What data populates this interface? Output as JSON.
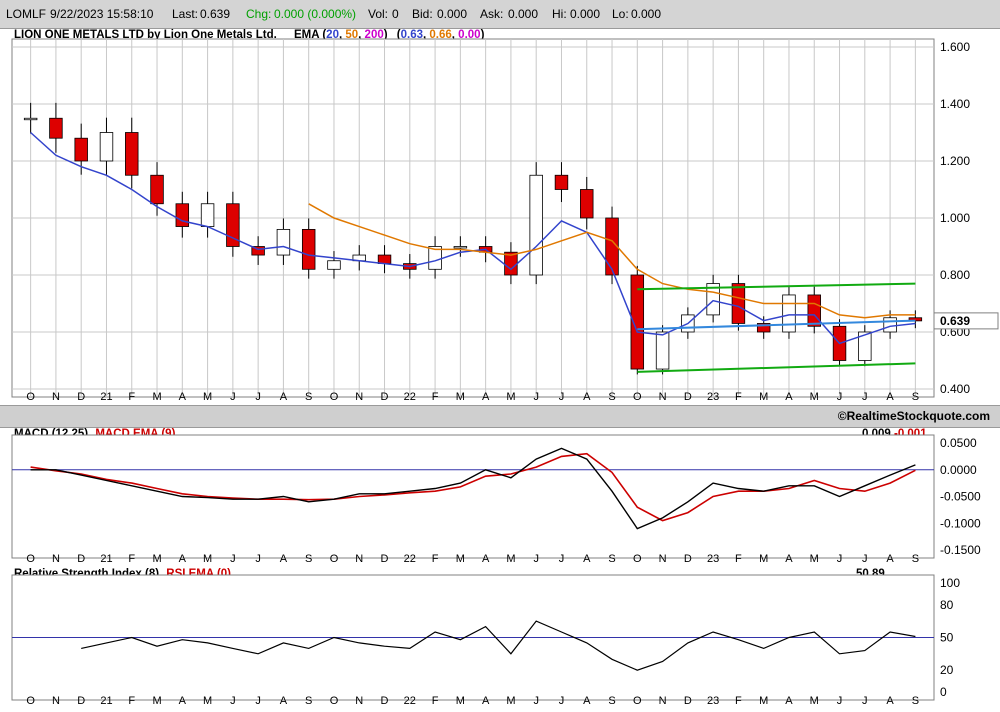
{
  "header": {
    "symbol": "LOMLF",
    "datetime": "9/22/2023 15:58:10",
    "last_label": "Last:",
    "last": "0.639",
    "chg_label": "Chg:",
    "chg": "0.000 (0.000%)",
    "vol_label": "Vol:",
    "vol": "0",
    "bid_label": "Bid:",
    "bid": "0.000",
    "ask_label": "Ask:",
    "ask": "0.000",
    "hi_label": "Hi:",
    "hi": "0.000",
    "lo_label": "Lo:",
    "lo": "0.000"
  },
  "colors": {
    "up": "#ffffff",
    "down": "#dd0000",
    "ema20": "#3344cc",
    "ema50": "#e07800",
    "ema200": "#cc00cc",
    "channel": "#11aa11",
    "channel_mid": "#3388dd",
    "macd": "#000000",
    "macd_signal": "#cc0000",
    "rsi": "#000000",
    "ref_line": "#3333aa",
    "grid": "#c8c8c8"
  },
  "price_panel": {
    "title": "LION ONE METALS LTD by Lion One Metals Ltd.",
    "ema_label": "EMA",
    "ema_periods": [
      "20",
      "50",
      "200"
    ],
    "ema_values": [
      "0.63",
      "0.66",
      "0.00"
    ],
    "last_price_label": "0.639",
    "y_ticks": [
      "1.600",
      "1.400",
      "1.200",
      "1.000",
      "0.800",
      "0.600",
      "0.400"
    ],
    "y_min": 0.4,
    "y_max": 1.6
  },
  "watermark": "©RealtimeStockquote.com",
  "x_axis_labels": [
    "O",
    "N",
    "D",
    "21",
    "F",
    "M",
    "A",
    "M",
    "J",
    "J",
    "A",
    "S",
    "O",
    "N",
    "D",
    "22",
    "F",
    "M",
    "A",
    "M",
    "J",
    "J",
    "A",
    "S",
    "O",
    "N",
    "D",
    "23",
    "F",
    "M",
    "A",
    "M",
    "J",
    "J",
    "A",
    "S"
  ],
  "macd_panel": {
    "title": "MACD (12,25)",
    "signal_label": "MACD EMA (9)",
    "value": "0.009",
    "signal_value": "-0.001",
    "y_ticks": [
      "0.0500",
      "0.0000",
      "-0.0500",
      "-0.1000",
      "-0.1500"
    ],
    "y_min": -0.15,
    "y_max": 0.05
  },
  "rsi_panel": {
    "title": "Relative Strength Index (8)",
    "ema_label": "RSI EMA (0)",
    "value": "50.89",
    "y_ticks": [
      "100",
      "80",
      "50",
      "20",
      "0"
    ],
    "y_min": 0,
    "y_max": 100
  },
  "chart_data": [
    {
      "type": "line",
      "name": "price",
      "x_labels": [
        "O",
        "N",
        "D",
        "21",
        "F",
        "M",
        "A",
        "M",
        "J",
        "J",
        "A",
        "S",
        "O",
        "N",
        "D",
        "22",
        "F",
        "M",
        "A",
        "M",
        "J",
        "J",
        "A",
        "S",
        "O",
        "N",
        "D",
        "23",
        "F",
        "M",
        "A",
        "M",
        "J",
        "J",
        "A",
        "S"
      ],
      "closes": [
        1.35,
        1.28,
        1.2,
        1.3,
        1.15,
        1.05,
        0.97,
        1.05,
        0.9,
        0.87,
        0.96,
        0.82,
        0.85,
        0.87,
        0.84,
        0.82,
        0.9,
        0.9,
        0.88,
        0.8,
        1.15,
        1.1,
        1.0,
        0.8,
        0.47,
        0.6,
        0.66,
        0.77,
        0.63,
        0.6,
        0.73,
        0.62,
        0.5,
        0.6,
        0.65,
        0.639
      ],
      "ema20": [
        1.3,
        1.22,
        1.18,
        1.15,
        1.1,
        1.04,
        0.99,
        0.97,
        0.93,
        0.89,
        0.9,
        0.87,
        0.86,
        0.85,
        0.84,
        0.83,
        0.85,
        0.88,
        0.89,
        0.82,
        0.9,
        0.99,
        0.95,
        0.82,
        0.6,
        0.59,
        0.63,
        0.71,
        0.69,
        0.64,
        0.66,
        0.66,
        0.56,
        0.59,
        0.62,
        0.63
      ],
      "ema50_x_start": 11,
      "ema50": [
        null,
        null,
        null,
        null,
        null,
        null,
        null,
        null,
        null,
        null,
        null,
        1.05,
        1.0,
        0.97,
        0.94,
        0.91,
        0.89,
        0.89,
        0.88,
        0.87,
        0.89,
        0.92,
        0.95,
        0.92,
        0.82,
        0.77,
        0.75,
        0.74,
        0.72,
        0.7,
        0.7,
        0.7,
        0.66,
        0.65,
        0.66,
        0.66
      ],
      "channel_upper": [
        [
          24,
          0.75
        ],
        [
          35,
          0.77
        ]
      ],
      "channel_mid": [
        [
          24,
          0.61
        ],
        [
          35,
          0.64
        ]
      ],
      "channel_lower": [
        [
          24,
          0.46
        ],
        [
          35,
          0.49
        ]
      ],
      "ylim": [
        0.4,
        1.6
      ]
    },
    {
      "type": "line",
      "name": "MACD (12,25)",
      "series": [
        {
          "name": "MACD (12,25)",
          "values": [
            0.0,
            0.0,
            -0.01,
            -0.02,
            -0.03,
            -0.04,
            -0.05,
            -0.052,
            -0.055,
            -0.055,
            -0.05,
            -0.06,
            -0.055,
            -0.045,
            -0.045,
            -0.04,
            -0.035,
            -0.025,
            0.0,
            -0.015,
            0.02,
            0.04,
            0.02,
            -0.04,
            -0.11,
            -0.09,
            -0.06,
            -0.025,
            -0.035,
            -0.04,
            -0.03,
            -0.03,
            -0.05,
            -0.03,
            -0.01,
            0.009
          ]
        },
        {
          "name": "MACD EMA (9)",
          "values": [
            0.005,
            -0.002,
            -0.008,
            -0.018,
            -0.025,
            -0.035,
            -0.045,
            -0.05,
            -0.053,
            -0.055,
            -0.055,
            -0.056,
            -0.055,
            -0.05,
            -0.047,
            -0.043,
            -0.04,
            -0.032,
            -0.012,
            -0.008,
            0.005,
            0.025,
            0.03,
            -0.005,
            -0.07,
            -0.095,
            -0.08,
            -0.05,
            -0.04,
            -0.04,
            -0.035,
            -0.02,
            -0.035,
            -0.04,
            -0.025,
            -0.001
          ]
        }
      ],
      "ylim": [
        -0.15,
        0.05
      ]
    },
    {
      "type": "line",
      "name": "Relative Strength Index (8)",
      "x_start": 2,
      "values": [
        null,
        null,
        40,
        45,
        50,
        42,
        48,
        45,
        40,
        35,
        45,
        40,
        50,
        45,
        42,
        40,
        55,
        48,
        60,
        35,
        65,
        55,
        45,
        30,
        20,
        28,
        45,
        55,
        48,
        40,
        50,
        55,
        35,
        38,
        55,
        50.89
      ],
      "reference": 50,
      "ylim": [
        0,
        100
      ]
    }
  ]
}
